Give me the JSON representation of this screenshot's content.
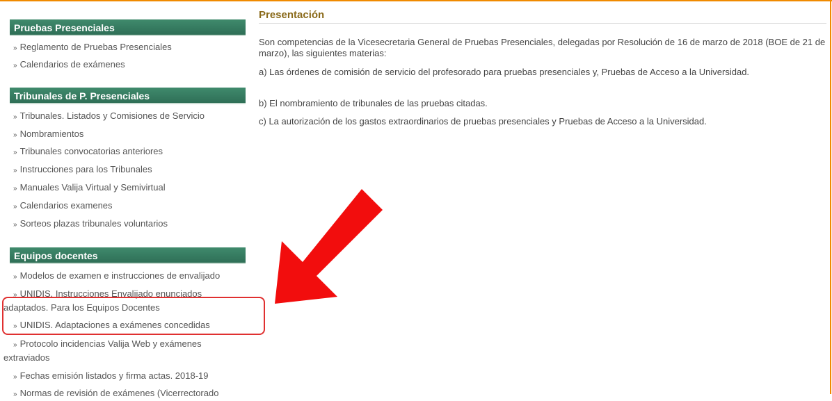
{
  "sidebar": {
    "sections": [
      {
        "title": "Pruebas Presenciales",
        "items": [
          "Reglamento de Pruebas Presenciales",
          "Calendarios de exámenes"
        ]
      },
      {
        "title": "Tribunales de P. Presenciales",
        "items": [
          "Tribunales. Listados y Comisiones de Servicio",
          "Nombramientos",
          "Tribunales convocatorias anteriores",
          "Instrucciones para los Tribunales",
          "Manuales Valija Virtual y Semivirtual",
          "Calendarios examenes",
          "Sorteos plazas tribunales voluntarios"
        ]
      },
      {
        "title": "Equipos docentes",
        "items": [
          "Modelos de examen e instrucciones de envalijado",
          "UNIDIS. Instrucciones Envalijado enunciados adaptados. Para los Equipos Docentes",
          "UNIDIS. Adaptaciones a exámenes concedidas",
          "Protocolo incidencias Valija Web y exámenes extraviados",
          "Fechas emisión listados y firma actas. 2018-19",
          "Normas de revisión de exámenes (Vicerrectorado"
        ]
      }
    ]
  },
  "main": {
    "title": "Presentación",
    "paragraphs": [
      "Son competencias de la Vicesecretaria General de Pruebas Presenciales, delegadas por Resolución de 16 de marzo de 2018 (BOE de 21 de marzo), las siguientes materias:",
      "a) Las órdenes de comisión de servicio del profesorado para pruebas presenciales y, Pruebas de Acceso a la Universidad.",
      "b) El nombramiento de tribunales de las pruebas citadas.",
      "c) La autorización de los gastos extraordinarios de pruebas presenciales y Pruebas de Acceso a la Universidad."
    ]
  },
  "bullet": "»",
  "colors": {
    "accent_orange": "#f08a00",
    "header_green": "#2f6f57",
    "title_brown": "#8a6a1a",
    "highlight_red": "#e03030"
  }
}
